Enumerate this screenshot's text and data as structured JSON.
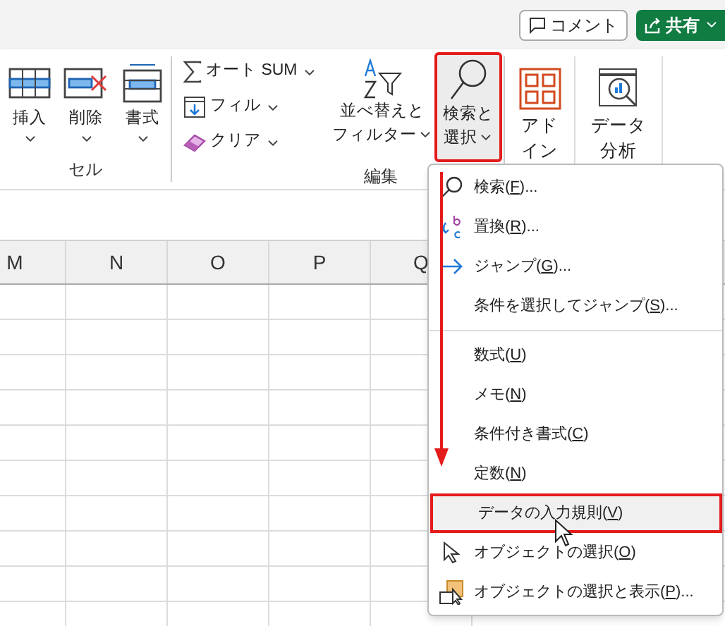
{
  "top_bar": {
    "buttons": [
      {
        "kind": "comment",
        "label": "コメント"
      },
      {
        "kind": "share",
        "label": "共有"
      }
    ]
  },
  "cells_group": {
    "label": "セル",
    "commands": [
      {
        "kind": "insert",
        "label": "挿入"
      },
      {
        "kind": "delete",
        "label": "削除"
      },
      {
        "kind": "format",
        "label": "書式"
      }
    ]
  },
  "editing_group": {
    "label": "編集",
    "commands": [
      {
        "kind": "autosum",
        "label": "オート SUM"
      },
      {
        "kind": "fill",
        "label": "フィル"
      },
      {
        "kind": "clear",
        "label": "クリア"
      }
    ],
    "sort_filter": {
      "lines": [
        "並べ替えと",
        "フィルター"
      ]
    },
    "find_select": {
      "lines": [
        "検索と",
        "選択"
      ],
      "highlighted": true
    }
  },
  "addins": {
    "lines": [
      "アド",
      "イン"
    ]
  },
  "data_analysis": {
    "lines": [
      "データ",
      "分析"
    ]
  },
  "columns": [
    "M",
    "N",
    "O",
    "P",
    "Q"
  ],
  "menu": {
    "sections": [
      [
        {
          "kind": "find",
          "before": "検索(",
          "key": "F",
          "after": ")...",
          "highlighted": false
        },
        {
          "kind": "replace",
          "before": "置換(",
          "key": "R",
          "after": ")...",
          "highlighted": false
        },
        {
          "kind": "goto",
          "before": "ジャンプ(",
          "key": "G",
          "after": ")...",
          "highlighted": false
        },
        {
          "kind": "plain",
          "before": "条件を選択してジャンプ(",
          "key": "S",
          "after": ")...",
          "highlighted": false
        }
      ],
      [
        {
          "kind": "plain",
          "before": "数式(",
          "key": "U",
          "after": ")",
          "highlighted": false
        },
        {
          "kind": "plain",
          "before": "メモ(",
          "key": "N",
          "after": ")",
          "highlighted": false
        },
        {
          "kind": "plain",
          "before": "条件付き書式(",
          "key": "C",
          "after": ")",
          "highlighted": false
        },
        {
          "kind": "plain",
          "before": "定数(",
          "key": "N",
          "after": ")",
          "highlighted": false
        },
        {
          "kind": "plain",
          "before": "データの入力規則(",
          "key": "V",
          "after": ")",
          "highlighted": true
        },
        {
          "kind": "select_objects",
          "before": "オブジェクトの選択(",
          "key": "O",
          "after": ")",
          "highlighted": false
        },
        {
          "kind": "selection_pane",
          "before": "オブジェクトの選択と表示(",
          "key": "P",
          "after": ")...",
          "highlighted": false
        }
      ]
    ]
  }
}
